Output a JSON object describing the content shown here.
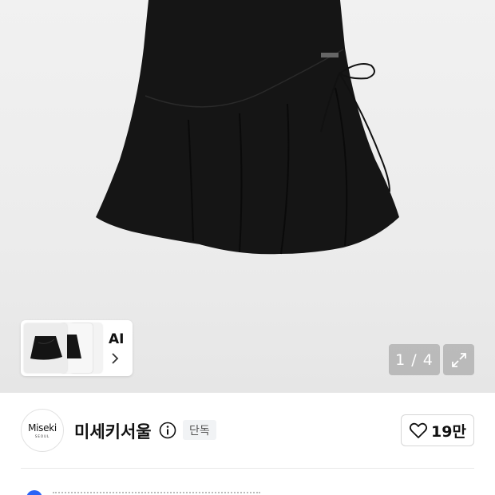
{
  "gallery": {
    "product_image": "black flared mini skirt with side tie",
    "counter": "1 / 4",
    "ai_label": "AI",
    "thumbnails": [
      "skirt-thumb-1",
      "skirt-thumb-2",
      "skirt-thumb-3"
    ],
    "expand_icon": "expand-arrows-icon"
  },
  "brand": {
    "logo_text": "Miseki",
    "logo_subtext": "SEOUL",
    "name": "미세키서울",
    "badge": "단독",
    "info_icon": "info-circle-icon"
  },
  "like": {
    "icon": "heart-outline-icon",
    "count": "19만"
  },
  "colors": {
    "accent_blue": "#2a64f6",
    "hero_bg": "#ececec",
    "overlay": "#969696"
  }
}
